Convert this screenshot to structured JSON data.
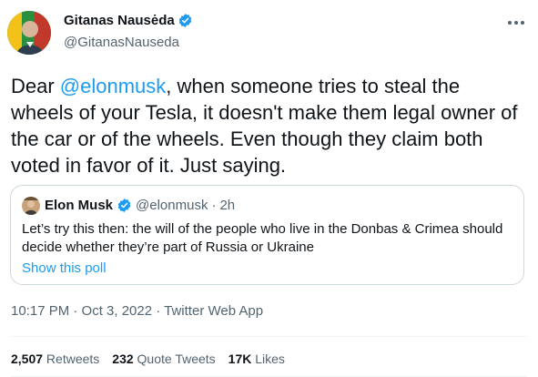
{
  "author": {
    "name": "Gitanas Nausėda",
    "handle": "@GitanasNauseda",
    "avatar_icon": "portrait-with-flag-avatar",
    "verified_icon": "verified-badge-icon",
    "more_icon": "more-options-icon"
  },
  "tweet": {
    "text_before": "Dear ",
    "mention": "@elonmusk",
    "text_after": ", when someone tries to steal the wheels of your Tesla, it doesn't make them legal owner of the car or of the wheels. Even though they claim both voted in favor of it. Just saying."
  },
  "quote": {
    "name": "Elon Musk",
    "handle": "@elonmusk",
    "separator": "·",
    "time": "2h",
    "text": "Let’s try this then: the will of the people who live in the Donbas & Crimea should decide whether they’re part of Russia or Ukraine",
    "poll_link": "Show this poll"
  },
  "meta": {
    "timestamp": "10:17 PM · Oct 3, 2022 · Twitter Web App"
  },
  "stats": {
    "retweets_count": "2,507",
    "retweets_label": " Retweets",
    "quotes_count": "232",
    "quotes_label": " Quote Tweets",
    "likes_count": "17K",
    "likes_label": " Likes"
  },
  "colors": {
    "link_blue": "#1d9bf0",
    "secondary_text": "#536471",
    "border": "#cfd9de"
  }
}
